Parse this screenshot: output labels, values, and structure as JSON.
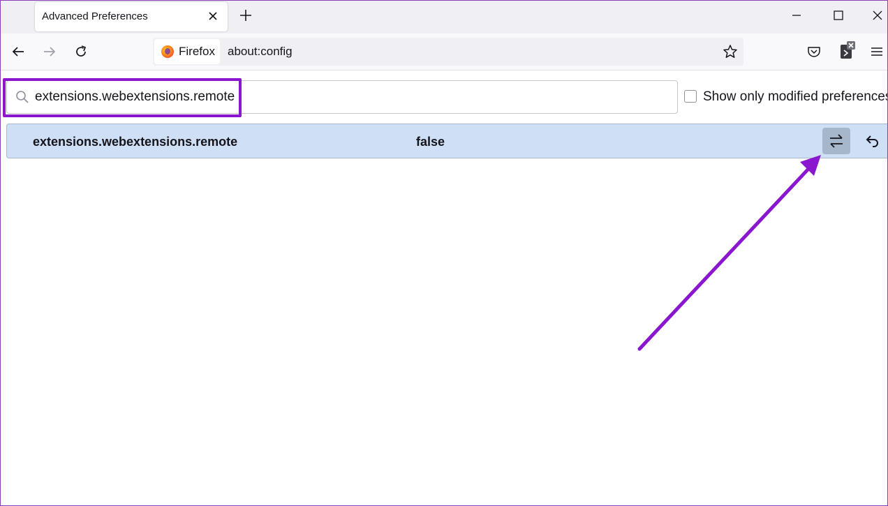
{
  "tab": {
    "title": "Advanced Preferences"
  },
  "toolbar": {
    "identity_label": "Firefox",
    "url": "about:config"
  },
  "search": {
    "value": "extensions.webextensions.remote"
  },
  "filter": {
    "checkbox_label": "Show only modified preferences",
    "checked": false
  },
  "preference": {
    "name": "extensions.webextensions.remote",
    "value": "false"
  },
  "icons": {
    "close_tab": "close-icon",
    "new_tab": "plus-icon",
    "back": "back-arrow-icon",
    "forward": "forward-arrow-icon",
    "reload": "reload-icon",
    "bookmark": "star-icon",
    "pocket": "pocket-icon",
    "extension": "extension-icon",
    "menu": "hamburger-menu-icon",
    "search": "search-icon",
    "toggle": "toggle-icon",
    "reset": "undo-icon"
  },
  "colors": {
    "annotation": "#8a16cf",
    "row_highlight": "#cfe0f6",
    "toggle_button": "#a6b6cb"
  }
}
